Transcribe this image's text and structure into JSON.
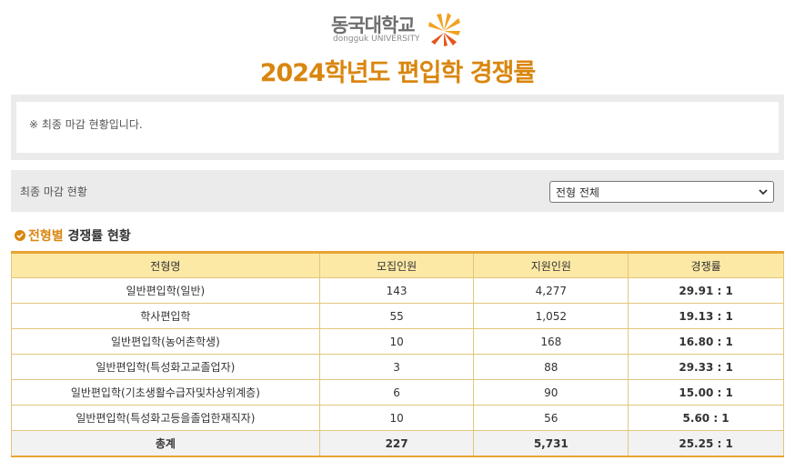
{
  "header": {
    "logo_ko": "동국대학교",
    "logo_en": "dongguk UNIVERSITY",
    "title": "2024학년도  편입학  경쟁률"
  },
  "notice": {
    "text": "※ 최종 마감 현황입니다."
  },
  "filter": {
    "label": "최종 마감 현황",
    "select_value": "전형 전체"
  },
  "section": {
    "title_highlight": "전형별",
    "title_rest": " 경쟁률 현황"
  },
  "table": {
    "headers": [
      "전형명",
      "모집인원",
      "지원인원",
      "경쟁률"
    ],
    "rows": [
      {
        "name": "일반편입학(일반)",
        "quota": "143",
        "applicants": "4,277",
        "rate": "29.91 : 1"
      },
      {
        "name": "학사편입학",
        "quota": "55",
        "applicants": "1,052",
        "rate": "19.13 : 1"
      },
      {
        "name": "일반편입학(농어촌학생)",
        "quota": "10",
        "applicants": "168",
        "rate": "16.80 : 1"
      },
      {
        "name": "일반편입학(특성화고교졸업자)",
        "quota": "3",
        "applicants": "88",
        "rate": "29.33 : 1"
      },
      {
        "name": "일반편입학(기초생활수급자및차상위계층)",
        "quota": "6",
        "applicants": "90",
        "rate": "15.00 : 1"
      },
      {
        "name": "일반편입학(특성화고등을졸업한재직자)",
        "quota": "10",
        "applicants": "56",
        "rate": "5.60 : 1"
      }
    ],
    "total": {
      "name": "총계",
      "quota": "227",
      "applicants": "5,731",
      "rate": "25.25 : 1"
    }
  },
  "colors": {
    "accent": "#d9860f",
    "table_header_bg": "#fde9a6",
    "table_border": "#e6a533"
  }
}
